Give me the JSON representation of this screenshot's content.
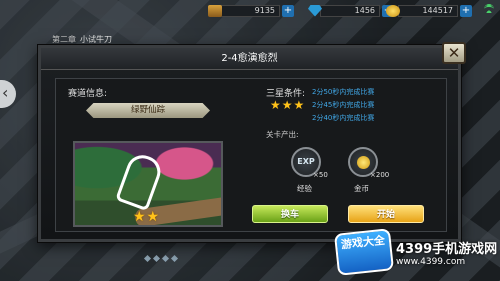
{
  "topbar": {
    "resources": [
      {
        "icon": "chest-icon",
        "value": "9135"
      },
      {
        "icon": "gem-icon",
        "value": "1456"
      },
      {
        "icon": "coin-icon",
        "value": "144517"
      }
    ],
    "plus_label": "+"
  },
  "chapter": {
    "label": "第二章",
    "name": "小试牛刀"
  },
  "dialog": {
    "title": "2-4愈演愈烈",
    "close_label": "✕",
    "track_info_label": "赛道信息:",
    "track_name": "绿野仙踪",
    "preview_stars": "★★",
    "three_star_label": "三星条件:",
    "three_star_stars": "★★★",
    "conditions": [
      "2分50秒内完成比赛",
      "2分45秒内完成比赛",
      "2分40秒内完成比赛"
    ],
    "drops_label": "关卡产出:",
    "rewards": [
      {
        "icon": "exp-icon",
        "icon_text": "EXP",
        "count": "×50",
        "label": "经验"
      },
      {
        "icon": "coin-icon",
        "count": "×200",
        "label": "金币"
      }
    ],
    "change_button": "换车",
    "start_button": "开始"
  },
  "watermark": {
    "logo_text": "游戏大全",
    "title": "4399手机游戏网",
    "url": "www.4399.com"
  },
  "colors": {
    "accent_blue": "#41a7e6",
    "star": "#ffc21a",
    "start_button": "#e7a317",
    "change_button": "#6aa217"
  }
}
